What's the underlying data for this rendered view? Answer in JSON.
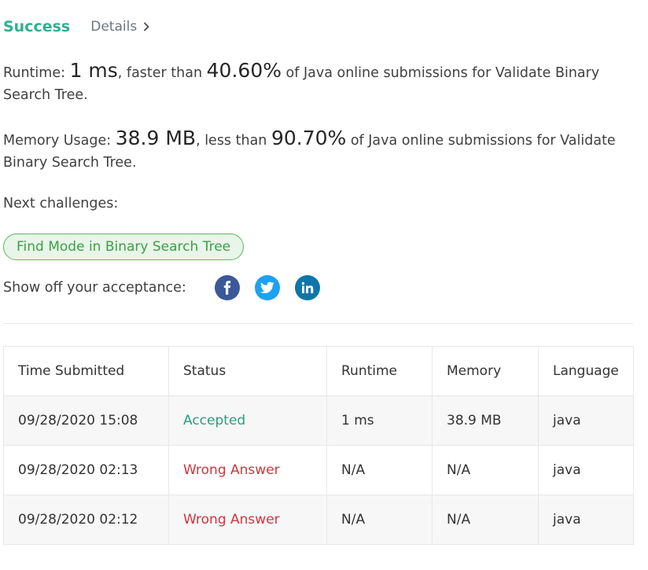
{
  "header": {
    "status": "Success",
    "details_label": "Details"
  },
  "runtime": {
    "label": "Runtime: ",
    "value": "1 ms",
    "mid": ", faster than ",
    "percent": "40.60%",
    "tail": " of Java online submissions for Validate Binary Search Tree."
  },
  "memory": {
    "label": "Memory Usage: ",
    "value": "38.9 MB",
    "mid": ", less than ",
    "percent": "90.70%",
    "tail": " of Java online submissions for Validate Binary Search Tree."
  },
  "next": {
    "label": "Next challenges:",
    "challenge": "Find Mode in Binary Search Tree"
  },
  "share": {
    "label": "Show off your acceptance:",
    "icons": [
      "facebook-icon",
      "twitter-icon",
      "linkedin-icon"
    ]
  },
  "colors": {
    "success": "#2db094",
    "accepted": "#2a9d7c",
    "wrong": "#d0353e",
    "challenge_border": "#5cb85c"
  },
  "table": {
    "headers": [
      "Time Submitted",
      "Status",
      "Runtime",
      "Memory",
      "Language"
    ],
    "rows": [
      {
        "time": "09/28/2020 15:08",
        "status": "Accepted",
        "runtime": "1 ms",
        "memory": "38.9 MB",
        "language": "java"
      },
      {
        "time": "09/28/2020 02:13",
        "status": "Wrong Answer",
        "runtime": "N/A",
        "memory": "N/A",
        "language": "java"
      },
      {
        "time": "09/28/2020 02:12",
        "status": "Wrong Answer",
        "runtime": "N/A",
        "memory": "N/A",
        "language": "java"
      }
    ]
  }
}
